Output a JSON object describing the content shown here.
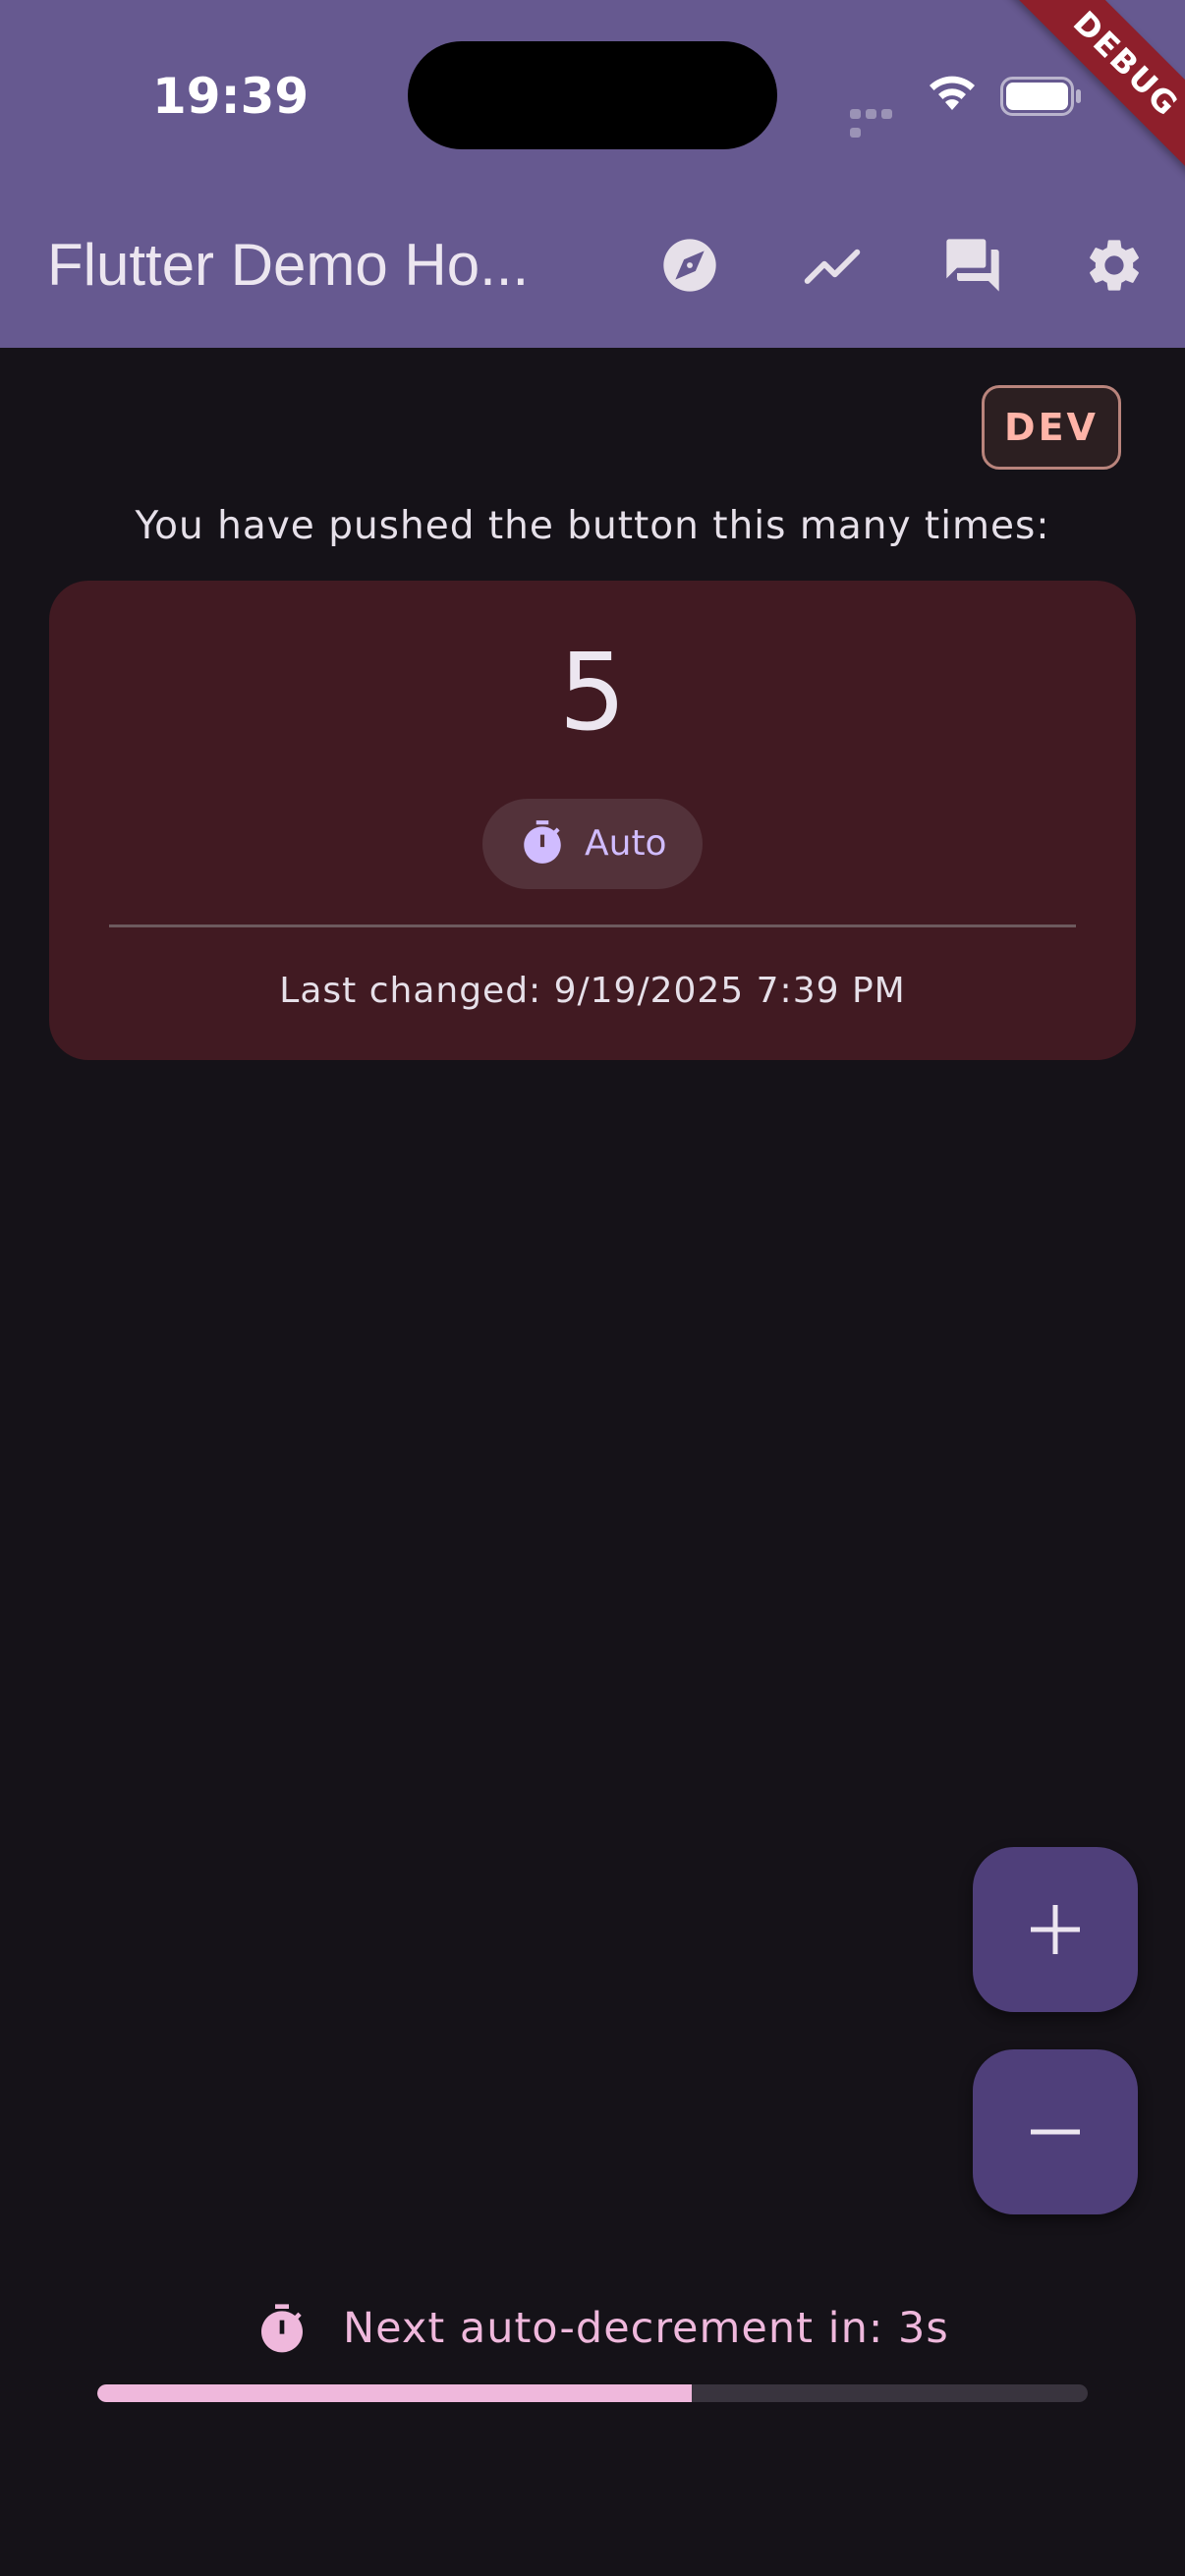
{
  "status_bar": {
    "time": "19:39",
    "debug_label": "DEBUG"
  },
  "app_bar": {
    "title": "Flutter Demo Ho...",
    "actions": [
      {
        "icon": "explore-icon"
      },
      {
        "icon": "trending-icon"
      },
      {
        "icon": "forum-icon"
      },
      {
        "icon": "settings-icon"
      }
    ]
  },
  "environment_badge": "DEV",
  "counter": {
    "label": "You have pushed the button this many times:",
    "value": "5",
    "mode_chip": "Auto",
    "last_changed": "Last changed: 9/19/2025 7:39 PM"
  },
  "fabs": {
    "increment": "+",
    "decrement": "−"
  },
  "auto_decrement": {
    "text": "Next auto-decrement in: 3s",
    "progress_fraction": 0.6
  },
  "colors": {
    "app_bar": "#665990",
    "background": "#151218",
    "card": "#411a22",
    "accent_pink": "#efb8dc",
    "fab": "#4f3f7a",
    "chip_text": "#d0bcff",
    "dev_badge_text": "#ffb4a8"
  }
}
